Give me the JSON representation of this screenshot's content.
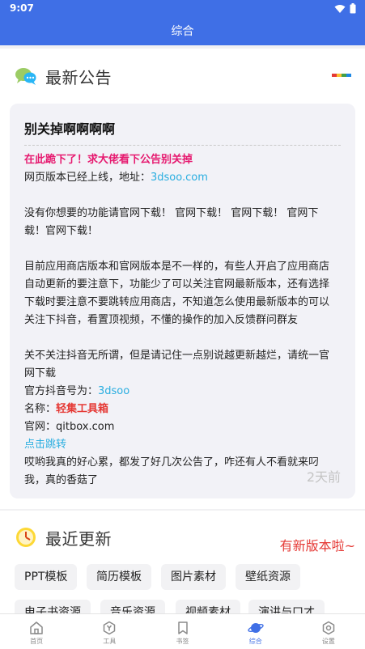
{
  "status": {
    "time": "9:07"
  },
  "appbar": {
    "title": "综合"
  },
  "notice": {
    "section_title": "最新公告",
    "title": "别关掉啊啊啊啊",
    "line1": "在此跪下了！求大佬看下公告别关掉",
    "line2_prefix": "网页版本已经上线，地址：",
    "line2_link": "3dsoo.com",
    "para1": [
      "没有你想要的功能请官网下载！ 官网下载！ 官网下载！ 官网下",
      "载！官网下载！"
    ],
    "para2": [
      "目前应用商店版本和官网版本是不一样的，有些人开启了应用商店",
      "自动更新的要注意下，功能少了可以关注官网最新版本，还有选择",
      "下载时要注意不要跳转应用商店，不知道怎么使用最新版本的可以",
      "关注下抖音，看置顶视频，不懂的操作的加入反馈群问群友"
    ],
    "para3": [
      "关不关注抖音无所谓，但是请记住一点别说越更新越烂，请统一官",
      "网下载"
    ],
    "douyin_prefix": "官方抖音号为：",
    "douyin_id": "3dsoo",
    "name_prefix": "名称：",
    "name_value": "轻集工具箱",
    "site_prefix": "官网：",
    "site_value": "qitbox.com",
    "jump_link": "点击跳转",
    "para4": [
      "哎哟我真的好心累，都发了好几次公告了，咋还有人不看就来叼",
      "我，真的香菇了"
    ],
    "time_ago": "2天前"
  },
  "updates": {
    "section_title": "最近更新",
    "new_version": "有新版本啦~",
    "tags": [
      "PPT模板",
      "简历模板",
      "图片素材",
      "壁纸资源",
      "电子书资源",
      "音乐资源",
      "视频素材",
      "演讲与口才"
    ]
  },
  "nav": {
    "items": [
      {
        "label": "首页",
        "icon": "home-icon"
      },
      {
        "label": "工具",
        "icon": "tools-icon"
      },
      {
        "label": "书签",
        "icon": "bookmark-icon"
      },
      {
        "label": "综合",
        "icon": "planet-icon",
        "active": true
      },
      {
        "label": "设置",
        "icon": "settings-icon"
      }
    ]
  },
  "colors": {
    "primary": "#3f6fe6",
    "accent_pink": "#e6196f",
    "link_cyan": "#2aaee0",
    "alert_red": "#e53935",
    "palette_bar": [
      "#e53935",
      "#fbc02d",
      "#43a047",
      "#1e88e5"
    ]
  }
}
